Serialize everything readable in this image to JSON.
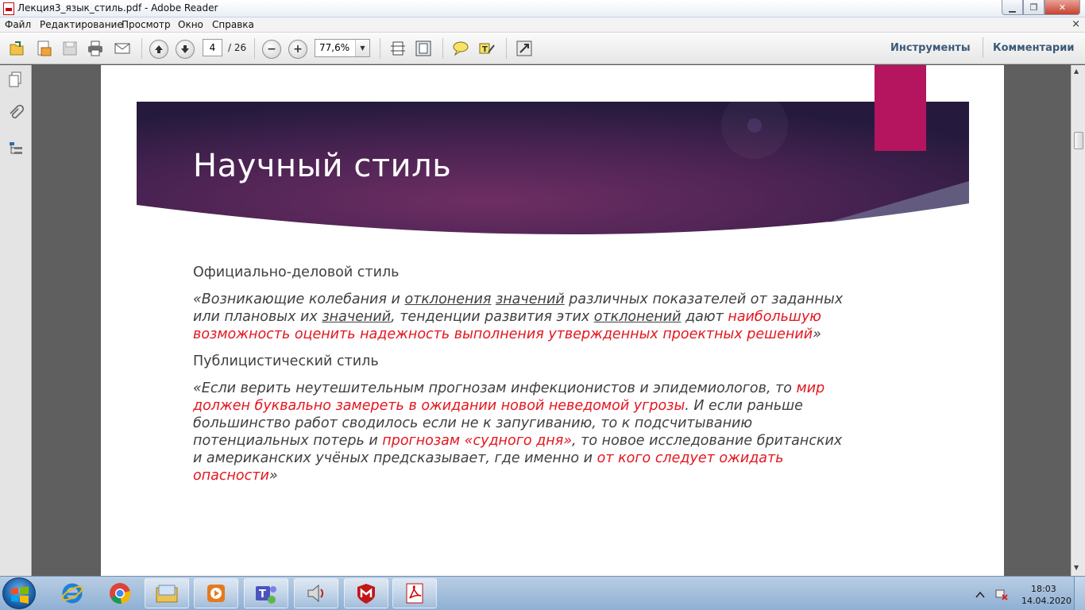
{
  "window": {
    "title": "Лекция3_язык_стиль.pdf - Adobe Reader",
    "minimize": "▁",
    "restore": "❐",
    "close": "✕"
  },
  "menu": {
    "items": [
      "Файл",
      "Редактирование",
      "Просмотр",
      "Окно",
      "Справка"
    ],
    "close_glyph": "×"
  },
  "toolbar": {
    "page_current": "4",
    "page_total": "/ 26",
    "zoom": "77,6%",
    "zoom_dropdown": "▼",
    "tools_label": "Инструменты",
    "comments_label": "Комментарии",
    "zoom_out_glyph": "−",
    "zoom_in_glyph": "+"
  },
  "slide": {
    "title": "Научный стиль",
    "section1_heading": "Официально-деловой стиль",
    "quote1": {
      "p1": "«Возникающие колебания и ",
      "u1": "отклонения",
      "p2": " ",
      "u2": "значений",
      "p3": " различных показателей от заданных или плановых их ",
      "u3": "значений",
      "p4": ", тенденции развития этих ",
      "u4": "отклонений",
      "p5": " дают ",
      "red1": "наибольшую возможность оценить надежность выполнения утвержденных проектных решений",
      "p6": "»"
    },
    "section2_heading": "Публицистический стиль",
    "quote2": {
      "p1": "«Если верить неутешительным прогнозам инфекционистов и эпидемиологов, то ",
      "red1": "мир должен буквально замереть в ожидании новой неведомой угрозы",
      "p2": ". И если раньше большинство работ сводилось если не к запугиванию, то к подсчитыванию потенциальных потерь и ",
      "red2": "прогнозам «судного дня»",
      "p3": ", то новое исследование британских и американских учёных предсказывает, где именно и ",
      "red3": "от кого следует ожидать опасности",
      "p4": "»"
    },
    "colors": {
      "banner_dark": "#2a1a45",
      "banner_mid": "#6b2e63",
      "ribbon": "#b5155e",
      "highlight": "#e3171f"
    }
  },
  "taskbar": {
    "time": "18:03",
    "date": "14.04.2020",
    "apps": [
      "internet-explorer-icon",
      "chrome-icon",
      "explorer-icon",
      "media-player-icon",
      "teams-icon",
      "powerpoint-icon",
      "mcafee-icon",
      "acrobat-icon"
    ]
  }
}
